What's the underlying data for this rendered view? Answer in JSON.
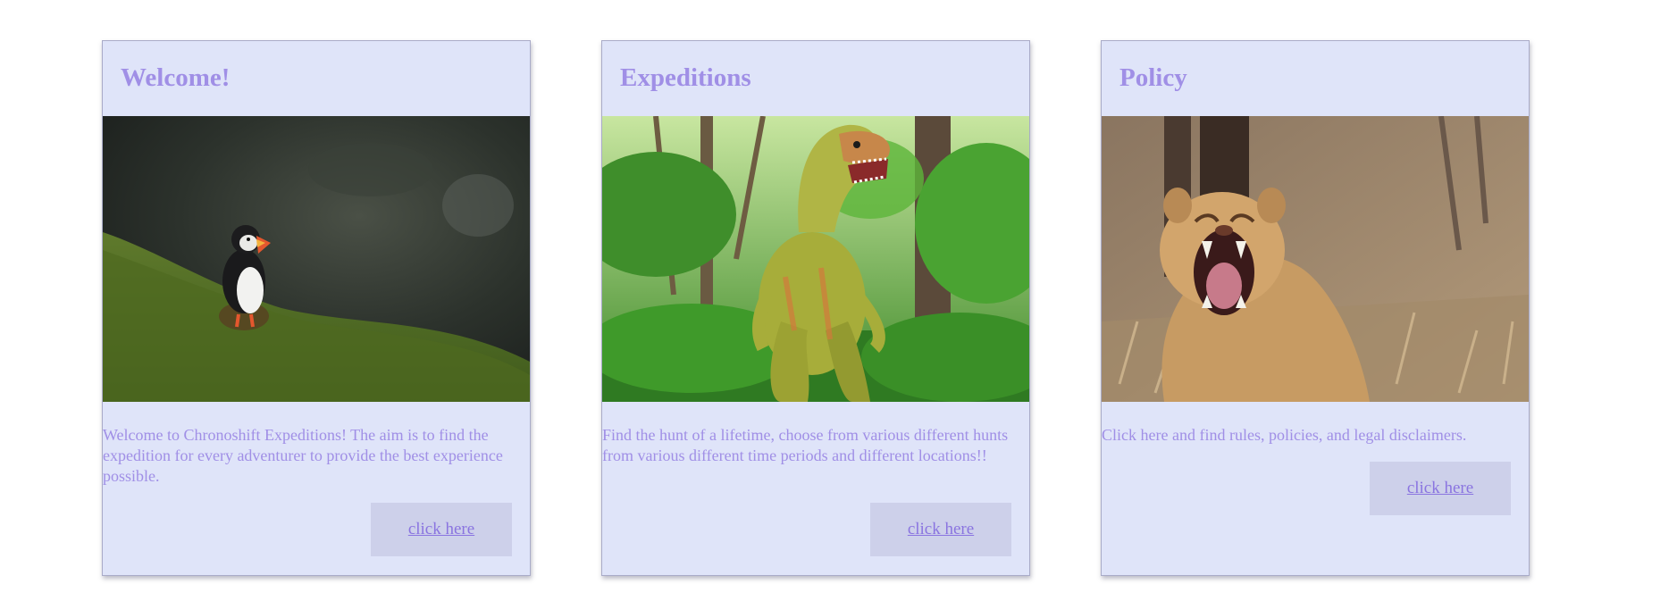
{
  "cards": [
    {
      "title": "Welcome!",
      "image": "puffin-photo",
      "text": "Welcome to Chronoshift Expeditions! The aim is to find the expedition for every adventurer to provide the best experience possible.",
      "button_label": "click here"
    },
    {
      "title": "Expeditions",
      "image": "dinosaur-photo",
      "text": "Find the hunt of a lifetime, choose from various different hunts from various different time periods and different locations!!",
      "button_label": "click here"
    },
    {
      "title": "Policy",
      "image": "roaring-lioness-photo",
      "text": "Click here and find rules, policies, and legal disclaimers.",
      "button_label": "click here"
    }
  ],
  "colors": {
    "card_background": "#dfe4f9",
    "accent_text": "#a08fe6",
    "button_background": "#cdd0ea",
    "link": "#8a74e0"
  }
}
